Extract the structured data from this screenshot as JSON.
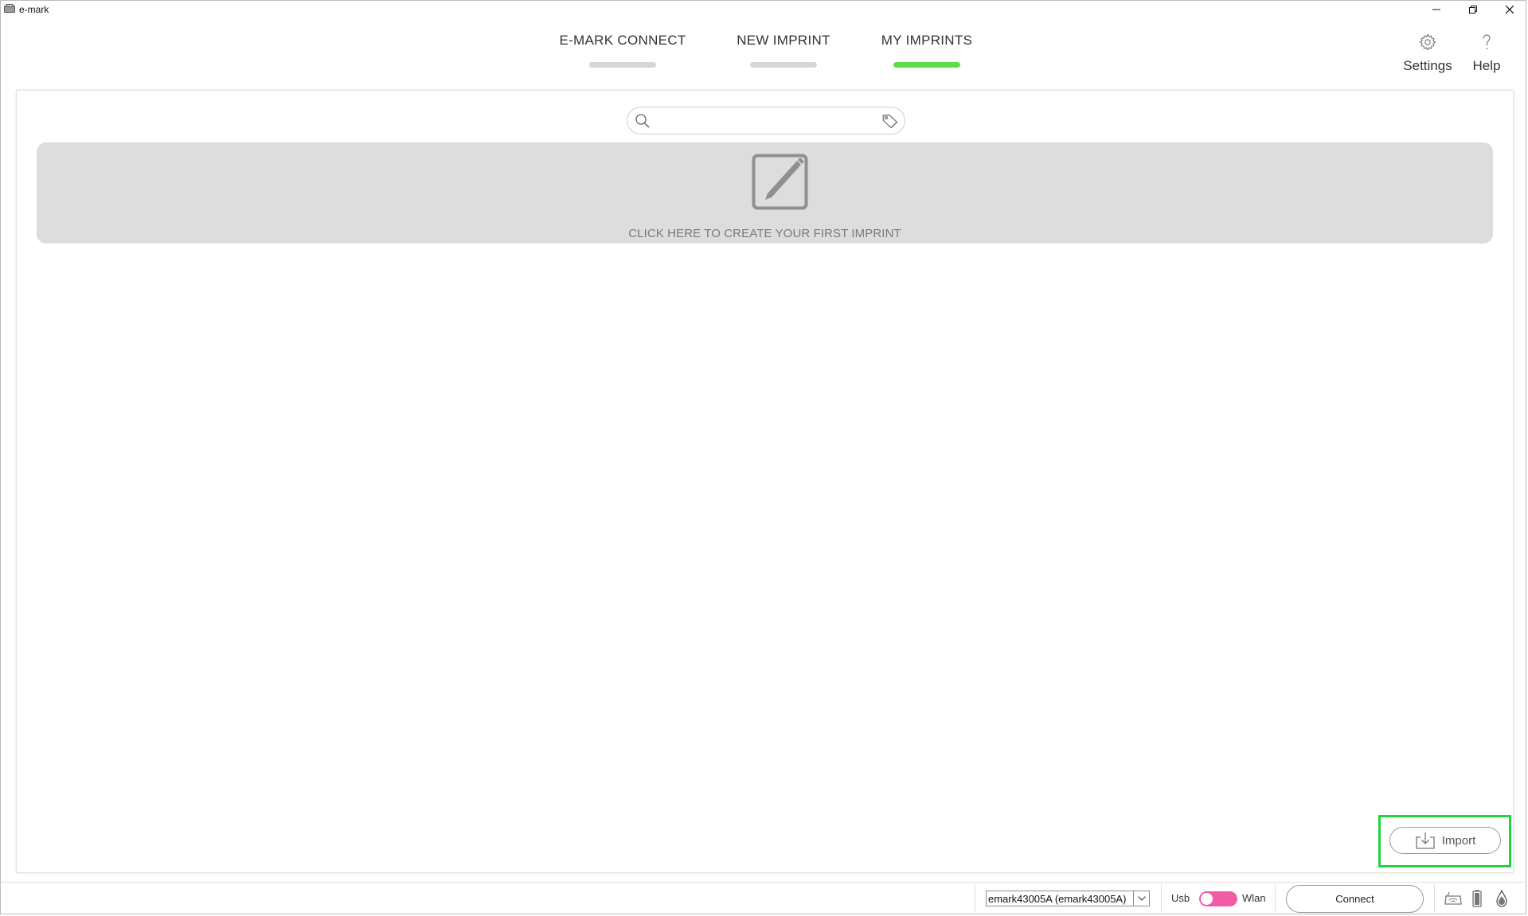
{
  "window": {
    "title": "e-mark"
  },
  "nav": {
    "tabs": [
      {
        "label": "E-MARK CONNECT",
        "active": false
      },
      {
        "label": "NEW IMPRINT",
        "active": false
      },
      {
        "label": "MY IMPRINTS",
        "active": true
      }
    ],
    "settings_label": "Settings",
    "help_label": "Help"
  },
  "main": {
    "search": {
      "value": "",
      "placeholder": ""
    },
    "create_prompt": "CLICK HERE TO CREATE YOUR FIRST IMPRINT",
    "import_label": "Import"
  },
  "status_bar": {
    "device_selected": "emark43005A (emark43005A)",
    "usb_label": "Usb",
    "wlan_label": "Wlan",
    "connect_label": "Connect"
  },
  "colors": {
    "active_tab": "#5fdc46",
    "inactive_tab": "#d6d6d6",
    "toggle": "#f25ca4",
    "highlight": "#1fd63a",
    "banner": "#dddddd"
  }
}
